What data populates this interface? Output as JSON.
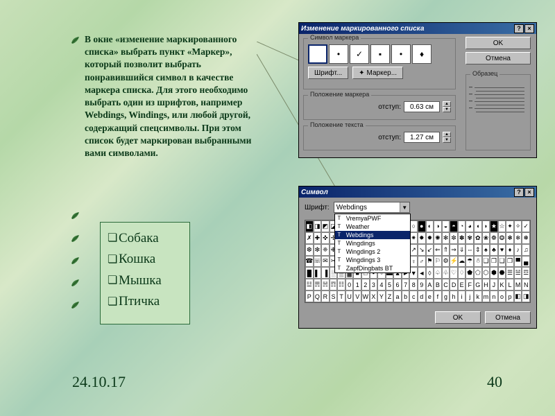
{
  "body_text": "В окне «изменение маркированного списка» выбрать пункт «Маркер», который позволит выбрать понравившийся символ в качестве маркера списка. Для этого необходимо выбрать один из шрифтов, например Webdings, Windings, или любой другой, содержащий спецсимволы. При этом список будет маркирован выбранными вами символами.",
  "example_list": [
    "Собака",
    "Кошка",
    "Мышка",
    "Птичка"
  ],
  "date": "24.10.17",
  "page_number": "40",
  "dialog1": {
    "title": "Изменение маркированного списка",
    "group_marker": "Символ маркера",
    "btn_font": "Шрифт...",
    "btn_marker": "Маркер...",
    "group_pos_marker": "Положение маркера",
    "group_pos_text": "Положение текста",
    "indent_label": "отступ:",
    "indent_marker_val": "0.63 см",
    "indent_text_val": "1.27 см",
    "group_sample": "Образец",
    "btn_ok": "OK",
    "btn_cancel": "Отмена",
    "markers": [
      "",
      "•",
      "✓",
      "▪",
      "•",
      "♦"
    ]
  },
  "dialog2": {
    "title": "Символ",
    "font_label": "Шрифт:",
    "font_selected": "Webdings",
    "font_options": [
      "VremyaPWF",
      "Weather",
      "Webdings",
      "Wingdings",
      "Wingdings 2",
      "Wingdings 3",
      "ZapfDingbats BT"
    ],
    "btn_ok": "OK",
    "btn_cancel": "Отмена"
  }
}
